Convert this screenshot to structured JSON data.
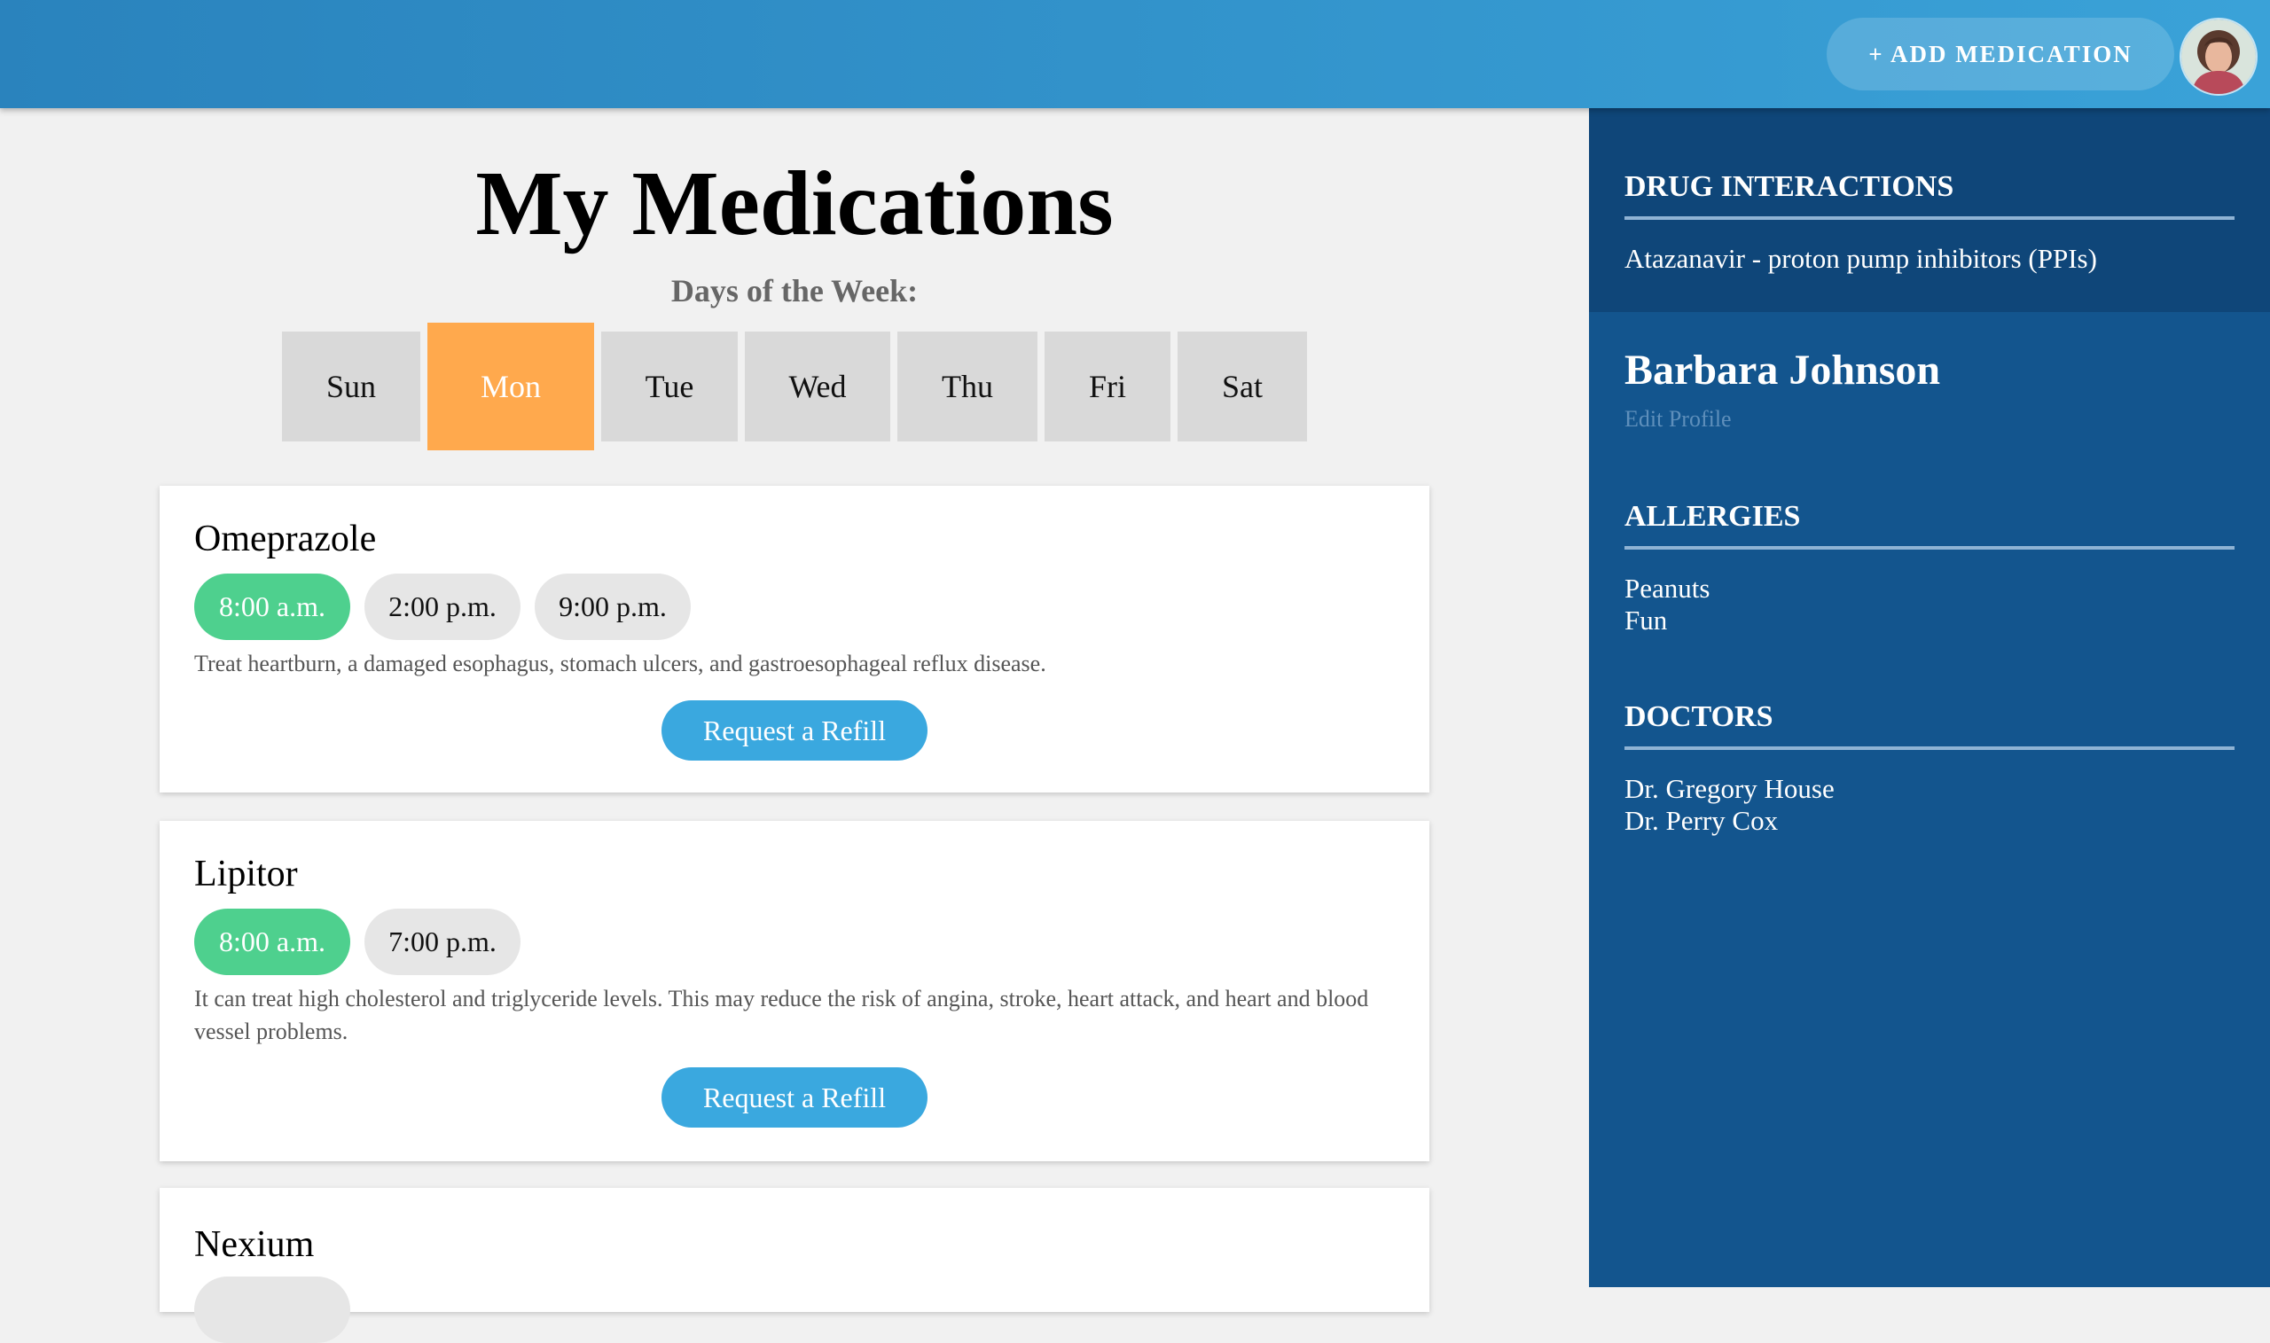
{
  "header": {
    "add_medication_label": "+ ADD MEDICATION",
    "avatar_icon": "user-avatar"
  },
  "main": {
    "title": "My Medications",
    "days_label": "Days of the Week:",
    "days": [
      "Sun",
      "Mon",
      "Tue",
      "Wed",
      "Thu",
      "Fri",
      "Sat"
    ],
    "active_day": "Mon",
    "medications": [
      {
        "name": "Omeprazole",
        "times": [
          "8:00 a.m.",
          "2:00 p.m.",
          "9:00 p.m."
        ],
        "active_time": "8:00 a.m.",
        "description": "Treat heartburn, a damaged esophagus, stomach ulcers, and gastroesophageal reflux disease.",
        "refill_label": "Request a Refill"
      },
      {
        "name": "Lipitor",
        "times": [
          "8:00 a.m.",
          "7:00 p.m."
        ],
        "active_time": "8:00 a.m.",
        "description": "It can treat high cholesterol and triglyceride levels. This may reduce the risk of angina, stroke, heart attack, and heart and blood vessel problems.",
        "refill_label": "Request a Refill"
      },
      {
        "name": "Nexium"
      }
    ]
  },
  "sidebar": {
    "drug_interactions": {
      "title": "DRUG INTERACTIONS",
      "items": [
        "Atazanavir - proton pump inhibitors (PPIs)"
      ]
    },
    "profile": {
      "name": "Barbara Johnson",
      "edit_label": "Edit Profile"
    },
    "allergies": {
      "title": "ALLERGIES",
      "items": [
        "Peanuts",
        "Fun"
      ]
    },
    "doctors": {
      "title": "DOCTORS",
      "items": [
        "Dr. Gregory House",
        "Dr. Perry Cox"
      ]
    }
  },
  "colors": {
    "header_start": "#2a83bd",
    "header_end": "#3aa2d8",
    "active_day": "#ffa94d",
    "active_time": "#4ed08e",
    "refill_button": "#3aa8df",
    "sidebar": "#13558e",
    "interactions_panel": "#0f4679"
  }
}
